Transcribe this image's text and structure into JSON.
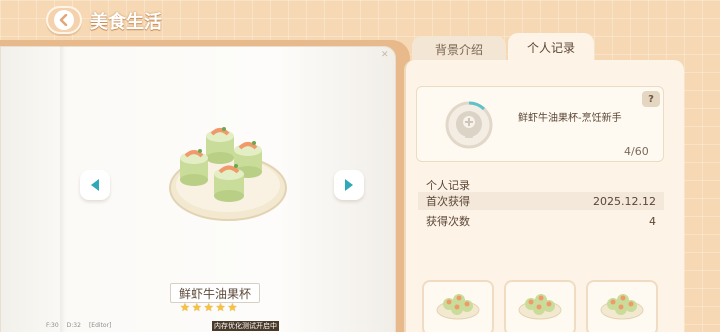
{
  "header": {
    "title": "美食生活"
  },
  "tabs": [
    {
      "label": "背景介绍",
      "active": false
    },
    {
      "label": "个人记录",
      "active": true
    }
  ],
  "dish": {
    "name": "鲜虾牛油果杯",
    "stars": 5,
    "icon": "shrimp-avocado-cup-image"
  },
  "summary": {
    "name": "鲜虾牛油果杯-烹饪新手",
    "progress": "4/60",
    "help": "?",
    "medal_icon": "medal-icon"
  },
  "record": {
    "section_title": "个人记录",
    "rows": [
      {
        "label": "首次获得",
        "value": "2025.12.12"
      },
      {
        "label": "获得次数",
        "value": "4"
      }
    ]
  },
  "footer": {
    "debug": [
      "F:30",
      "D:32",
      "[Editor]"
    ],
    "notice": "内存优化测试开启中"
  },
  "colors": {
    "background": "#f6d9b4",
    "panel": "#fdf3e6",
    "star": "#f7c23c",
    "arrow": "#2fa8b8"
  }
}
